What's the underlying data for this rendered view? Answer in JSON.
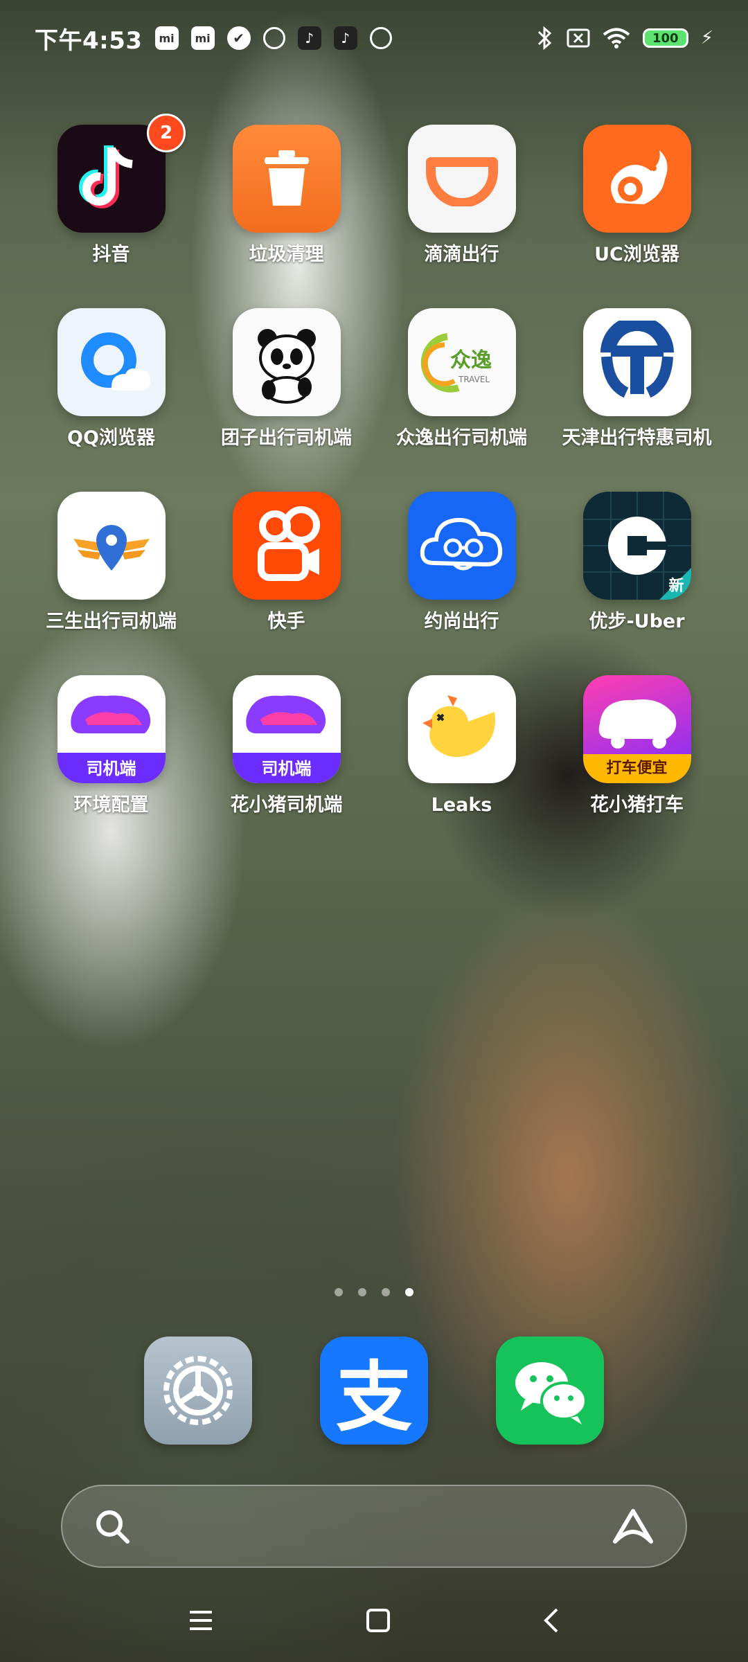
{
  "status_bar": {
    "time": "下午4:53",
    "battery": "100"
  },
  "apps": [
    {
      "label": "抖音",
      "icon": "tiktok-icon",
      "badge": "2"
    },
    {
      "label": "垃圾清理",
      "icon": "trash-icon"
    },
    {
      "label": "滴滴出行",
      "icon": "didi-icon"
    },
    {
      "label": "UC浏览器",
      "icon": "uc-browser-icon"
    },
    {
      "label": "QQ浏览器",
      "icon": "qq-browser-icon"
    },
    {
      "label": "团子出行司机端",
      "icon": "panda-icon"
    },
    {
      "label": "众逸出行司机端",
      "icon": "zhongyi-icon",
      "icon_text": "众逸",
      "icon_subtext": "TRAVEL"
    },
    {
      "label": "天津出行特惠司机",
      "icon": "tianjin-icon"
    },
    {
      "label": "三生出行司机端",
      "icon": "location-wings-icon"
    },
    {
      "label": "快手",
      "icon": "kuaishou-icon"
    },
    {
      "label": "约尚出行",
      "icon": "cloud-face-icon"
    },
    {
      "label": "优步-Uber",
      "icon": "uber-icon",
      "icon_tag": "新"
    },
    {
      "label": "环境配置",
      "icon": "pig-driver-icon",
      "icon_text": "司机端"
    },
    {
      "label": "花小猪司机端",
      "icon": "pig-driver-icon",
      "icon_text": "司机端"
    },
    {
      "label": "Leaks",
      "icon": "duck-icon"
    },
    {
      "label": "花小猪打车",
      "icon": "pig-taxi-icon",
      "icon_text": "打车便宜"
    }
  ],
  "dock": [
    {
      "name": "settings",
      "icon": "settings-gear-icon"
    },
    {
      "name": "alipay",
      "icon": "alipay-icon",
      "icon_text": "支"
    },
    {
      "name": "wechat",
      "icon": "wechat-icon"
    }
  ],
  "colors": {
    "badge": "#ff4a1f",
    "battery": "#5ce36f"
  }
}
